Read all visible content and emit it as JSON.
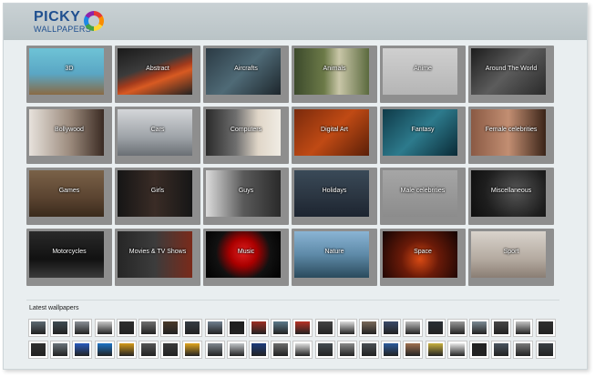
{
  "brand": {
    "name_top": "PICKY",
    "name_bottom": "WALLPAPERS"
  },
  "categories": [
    {
      "label": "3D",
      "bg": "linear-gradient(#6ec3d6 0%,#5aa6c4 55%,#8a6a44 100%)"
    },
    {
      "label": "Abstract",
      "bg": "linear-gradient(160deg,#1a1a1a 0%,#3b3b3b 40%,#a23a1c 55%,#d85a22 65%,#222 100%)"
    },
    {
      "label": "Aircrafts",
      "bg": "linear-gradient(135deg,#2b3a44,#4f6a76 50%,#1d262c)"
    },
    {
      "label": "Animals",
      "bg": "linear-gradient(90deg,#3c4a2c,#6c7a48 40%,#c9c6a8 60%,#5b6a3e)"
    },
    {
      "label": "Anime",
      "bg": "linear-gradient(#cfcfcf,#b5b5b5)"
    },
    {
      "label": "Around The World",
      "bg": "linear-gradient(135deg,#1d1d1d,#5c5c5c 50%,#2a2a2a)"
    },
    {
      "label": "Bollywood",
      "bg": "linear-gradient(90deg,#e7e2dc,#9b8a7c 55%,#3a2a22)"
    },
    {
      "label": "Cars",
      "bg": "linear-gradient(#d4d6d9,#9ea3a8 60%,#6a6f74)"
    },
    {
      "label": "Computers",
      "bg": "linear-gradient(90deg,#2a2a2a,#6e6e6e 40%,#e0d6c8 70%,#f0ece4)"
    },
    {
      "label": "Digital Art",
      "bg": "linear-gradient(135deg,#7a2a0c,#c04a14 50%,#5a1f08)"
    },
    {
      "label": "Fantasy",
      "bg": "linear-gradient(135deg,#0f3a48,#2d7a8c 50%,#0a2a36)"
    },
    {
      "label": "Female celebrities",
      "bg": "linear-gradient(90deg,#8a5a44,#c28e72 50%,#3a2418)"
    },
    {
      "label": "Games",
      "bg": "linear-gradient(#7a6248,#5a4330 60%,#3a2a1c)"
    },
    {
      "label": "Girls",
      "bg": "linear-gradient(90deg,#151515,#3a2c26 50%,#161616)"
    },
    {
      "label": "Guys",
      "bg": "linear-gradient(90deg,#dcdcdc,#5a5a5a 50%,#2a2a2a)"
    },
    {
      "label": "Holidays",
      "bg": "linear-gradient(#3a4a58,#2a3440 60%,#1c2430)"
    },
    {
      "label": "Male celebrities",
      "bg": "linear-gradient(#a6a6a6,#8c8c8c)"
    },
    {
      "label": "Miscellaneous",
      "bg": "radial-gradient(circle at 60% 45%,#555 0%,#1e1e1e 60%,#0e0e0e 100%)"
    },
    {
      "label": "Motorcycles",
      "bg": "linear-gradient(#2a2a2a,#111 60%,#3a3a3a)"
    },
    {
      "label": "Movies & TV Shows",
      "bg": "linear-gradient(90deg,#262626,#3c3c3c 50%,#7a2a1a)"
    },
    {
      "label": "Music",
      "bg": "radial-gradient(circle at 50% 45%,#e02020 0%,#a00 30%,#111 60%,#000 100%)"
    },
    {
      "label": "Nature",
      "bg": "linear-gradient(#8ab4d4 0%,#5e8aa8 50%,#2a4a5c 100%)"
    },
    {
      "label": "Space",
      "bg": "radial-gradient(circle at 50% 60%,#d84a14 0%,#6a1a08 40%,#120404 100%)"
    },
    {
      "label": "Sport",
      "bg": "linear-gradient(#d9d3cc,#b4aaa0 60%,#8a7e74)"
    }
  ],
  "latest": {
    "title": "Latest wallpapers",
    "thumbs": [
      {
        "color": "#5d6a73"
      },
      {
        "color": "#3f4b52"
      },
      {
        "color": "#8a9097"
      },
      {
        "color": "#c8c8c8"
      },
      {
        "color": "#2e2e2e"
      },
      {
        "color": "#6f6f6f"
      },
      {
        "color": "#4a3a2a"
      },
      {
        "color": "#353c44"
      },
      {
        "color": "#708090"
      },
      {
        "color": "#1f1f1f"
      },
      {
        "color": "#9c2e22"
      },
      {
        "color": "#5c7a8a"
      },
      {
        "color": "#b73326"
      },
      {
        "color": "#444"
      },
      {
        "color": "#dcdcdc"
      },
      {
        "color": "#7a6a5a"
      },
      {
        "color": "#3a4a6a"
      },
      {
        "color": "#bcbcbc"
      },
      {
        "color": "#2a2f35"
      },
      {
        "color": "#999"
      },
      {
        "color": "#7c8a94"
      },
      {
        "color": "#484848"
      },
      {
        "color": "#c2c2c2"
      },
      {
        "color": "#303030"
      },
      {
        "color": "#2f2f2f"
      },
      {
        "color": "#6a737a"
      },
      {
        "color": "#2a5bbd"
      },
      {
        "color": "#1e73c4"
      },
      {
        "color": "#d49a1a"
      },
      {
        "color": "#555"
      },
      {
        "color": "#3a3a3a"
      },
      {
        "color": "#e0a520"
      },
      {
        "color": "#808890"
      },
      {
        "color": "#c0c4c8"
      },
      {
        "color": "#1c3c7c"
      },
      {
        "color": "#6d6d6d"
      },
      {
        "color": "#dedede"
      },
      {
        "color": "#454c52"
      },
      {
        "color": "#8a8a8a"
      },
      {
        "color": "#4a4f54"
      },
      {
        "color": "#2c5b9c"
      },
      {
        "color": "#a07050"
      },
      {
        "color": "#c8b040"
      },
      {
        "color": "#e8e8e8"
      },
      {
        "color": "#222"
      },
      {
        "color": "#4a5560"
      },
      {
        "color": "#7a7a7a"
      },
      {
        "color": "#3a3f44"
      }
    ]
  }
}
